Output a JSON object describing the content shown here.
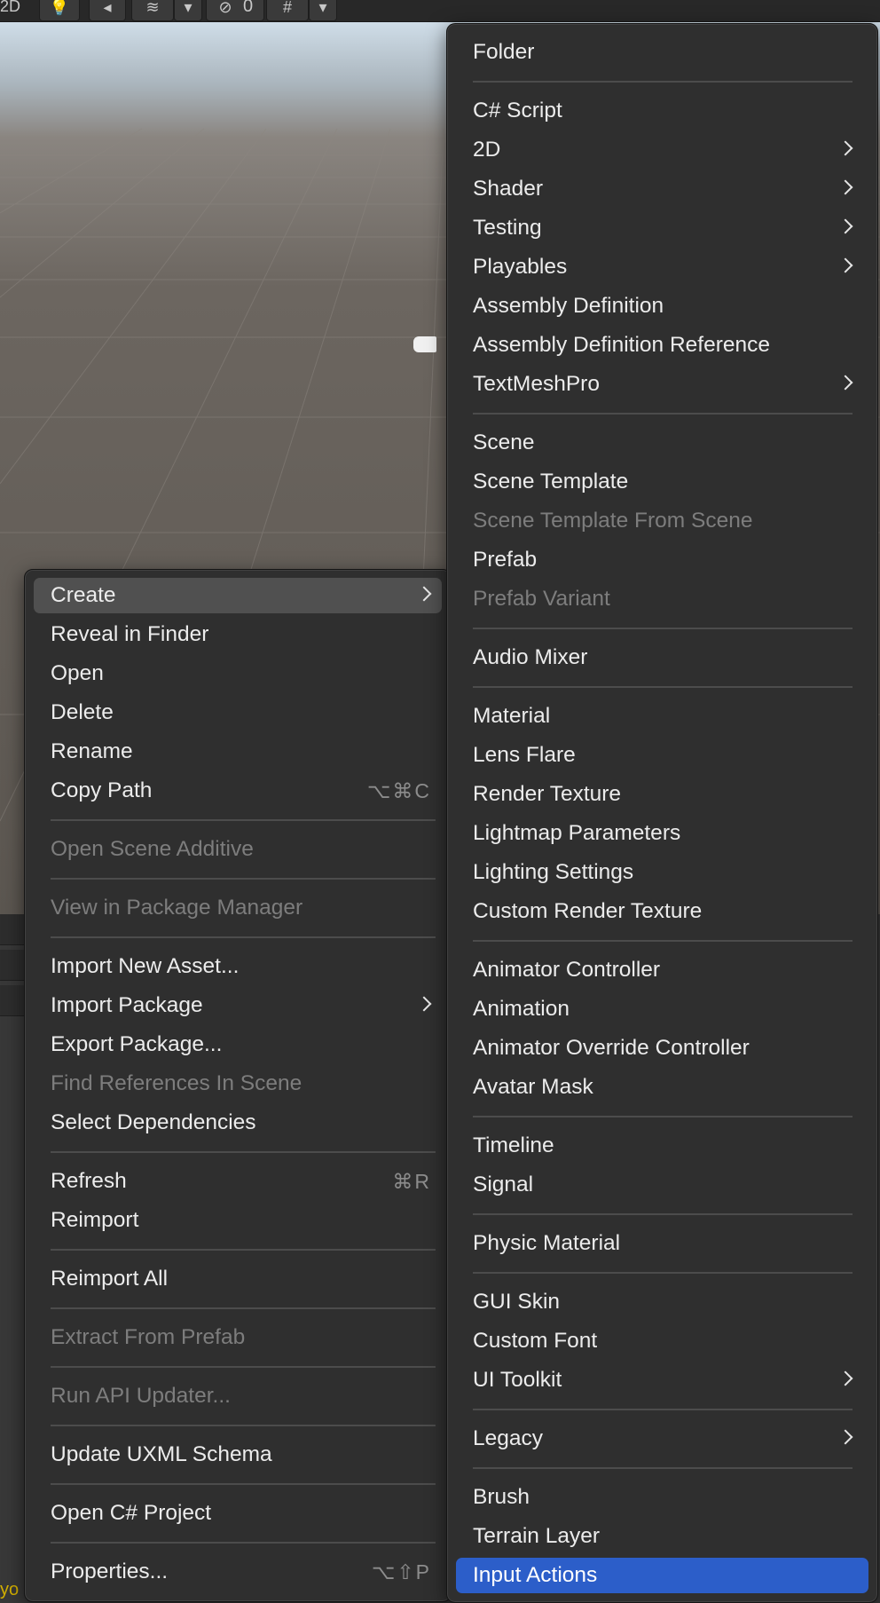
{
  "toolbar": {
    "mode_label": "2D",
    "hidden_count": "0"
  },
  "context_menu": {
    "items": [
      {
        "label": "Create",
        "has_submenu": true,
        "state": "hover"
      },
      {
        "label": "Reveal in Finder"
      },
      {
        "label": "Open"
      },
      {
        "label": "Delete"
      },
      {
        "label": "Rename"
      },
      {
        "label": "Copy Path",
        "shortcut": "⌥⌘C"
      },
      {
        "label": "Open Scene Additive",
        "disabled": true
      },
      {
        "label": "View in Package Manager",
        "disabled": true
      },
      {
        "label": "Import New Asset..."
      },
      {
        "label": "Import Package",
        "has_submenu": true
      },
      {
        "label": "Export Package..."
      },
      {
        "label": "Find References In Scene",
        "disabled": true
      },
      {
        "label": "Select Dependencies"
      },
      {
        "label": "Refresh",
        "shortcut": "⌘R"
      },
      {
        "label": "Reimport"
      },
      {
        "label": "Reimport All"
      },
      {
        "label": "Extract From Prefab",
        "disabled": true
      },
      {
        "label": "Run API Updater...",
        "disabled": true
      },
      {
        "label": "Update UXML Schema"
      },
      {
        "label": "Open C# Project"
      },
      {
        "label": "Properties...",
        "shortcut": "⌥⇧P"
      }
    ]
  },
  "create_menu": {
    "items": [
      {
        "label": "Folder"
      },
      {
        "label": "C# Script"
      },
      {
        "label": "2D",
        "has_submenu": true
      },
      {
        "label": "Shader",
        "has_submenu": true
      },
      {
        "label": "Testing",
        "has_submenu": true
      },
      {
        "label": "Playables",
        "has_submenu": true
      },
      {
        "label": "Assembly Definition"
      },
      {
        "label": "Assembly Definition Reference"
      },
      {
        "label": "TextMeshPro",
        "has_submenu": true
      },
      {
        "label": "Scene"
      },
      {
        "label": "Scene Template"
      },
      {
        "label": "Scene Template From Scene",
        "disabled": true
      },
      {
        "label": "Prefab"
      },
      {
        "label": "Prefab Variant",
        "disabled": true
      },
      {
        "label": "Audio Mixer"
      },
      {
        "label": "Material"
      },
      {
        "label": "Lens Flare"
      },
      {
        "label": "Render Texture"
      },
      {
        "label": "Lightmap Parameters"
      },
      {
        "label": "Lighting Settings"
      },
      {
        "label": "Custom Render Texture"
      },
      {
        "label": "Animator Controller"
      },
      {
        "label": "Animation"
      },
      {
        "label": "Animator Override Controller"
      },
      {
        "label": "Avatar Mask"
      },
      {
        "label": "Timeline"
      },
      {
        "label": "Signal"
      },
      {
        "label": "Physic Material"
      },
      {
        "label": "GUI Skin"
      },
      {
        "label": "Custom Font"
      },
      {
        "label": "UI Toolkit",
        "has_submenu": true
      },
      {
        "label": "Legacy",
        "has_submenu": true
      },
      {
        "label": "Brush"
      },
      {
        "label": "Terrain Layer"
      },
      {
        "label": "Input Actions",
        "state": "selected"
      }
    ]
  },
  "console_peek": "yo",
  "colors": {
    "menu_bg": "#2f2f2f",
    "hover_bg": "#505050",
    "selected_bg": "#2c5ec9",
    "disabled_text": "#7d7d7d"
  }
}
